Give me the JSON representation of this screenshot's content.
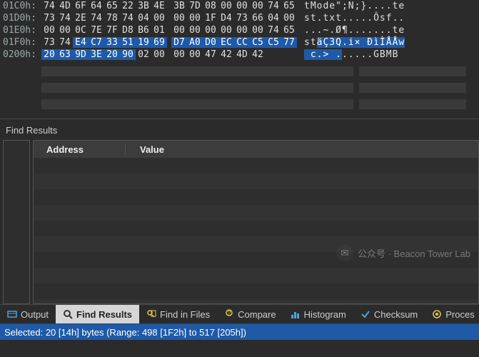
{
  "hex": {
    "rows": [
      {
        "offset": "01C0h:",
        "bytes": [
          "74",
          "4D",
          "6F",
          "64",
          "65",
          "22",
          "3B",
          "4E",
          "3B",
          "7D",
          "08",
          "00",
          "00",
          "00",
          "74",
          "65"
        ],
        "sel": [],
        "ascii_plain": "tMode\";N;}....te",
        "ascii_sel": ""
      },
      {
        "offset": "01D0h:",
        "bytes": [
          "73",
          "74",
          "2E",
          "74",
          "78",
          "74",
          "04",
          "00",
          "00",
          "00",
          "1F",
          "D4",
          "73",
          "66",
          "04",
          "00"
        ],
        "sel": [],
        "ascii_plain": "st.txt.....Ôsf..",
        "ascii_sel": ""
      },
      {
        "offset": "01E0h:",
        "bytes": [
          "00",
          "00",
          "0C",
          "7E",
          "7F",
          "D8",
          "B6",
          "01",
          "00",
          "00",
          "00",
          "00",
          "00",
          "00",
          "74",
          "65"
        ],
        "sel": [],
        "ascii_plain": "...~.Ø¶.......te",
        "ascii_sel": ""
      },
      {
        "offset": "01F0h:",
        "bytes": [
          "73",
          "74",
          "E4",
          "C7",
          "33",
          "51",
          "19",
          "69",
          "D7",
          "A0",
          "D0",
          "EC",
          "CC",
          "C5",
          "C5",
          "77"
        ],
        "sel": [
          2,
          3,
          4,
          5,
          6,
          7,
          8,
          9,
          10,
          11,
          12,
          13,
          14,
          15
        ],
        "ascii_plain": "st",
        "ascii_sel": "äÇ3Q.i× ÐìÌÅÅw"
      },
      {
        "offset": "0200h:",
        "bytes": [
          "20",
          "63",
          "9D",
          "3E",
          "20",
          "90",
          "02",
          "00",
          "00",
          "00",
          "47",
          "42",
          "4D",
          "42",
          "",
          ""
        ],
        "sel": [
          0,
          1,
          2,
          3,
          4,
          5
        ],
        "ascii_plain": ".....GBMB",
        "ascii_sel": " c.> ."
      }
    ]
  },
  "find": {
    "title": "Find Results",
    "columns": {
      "address": "Address",
      "value": "Value"
    }
  },
  "tabs": {
    "output": "Output",
    "find_results": "Find Results",
    "find_in_files": "Find in Files",
    "compare": "Compare",
    "histogram": "Histogram",
    "checksum": "Checksum",
    "process": "Proces"
  },
  "status": {
    "text": "Selected: 20 [14h] bytes (Range: 498 [1F2h] to 517 [205h])"
  },
  "watermark": {
    "text": "公众号 · Beacon Tower Lab"
  },
  "colors": {
    "selection": "#1e5aa8"
  }
}
